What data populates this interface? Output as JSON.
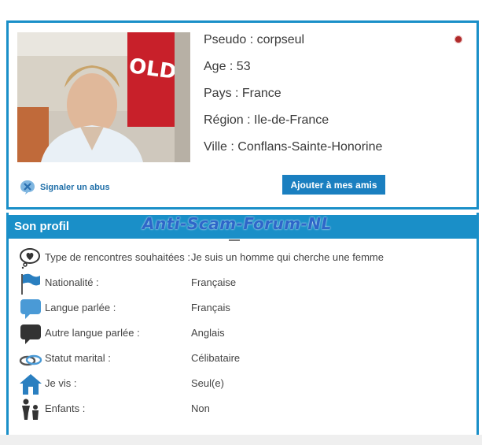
{
  "user": {
    "pseudo": "Pseudo : corpseul",
    "age": "Age : 53",
    "pays": "Pays : France",
    "region": "Région : Ile-de-France",
    "ville": "Ville : Conflans-Sainte-Honorine"
  },
  "actions": {
    "report_label": "Signaler un abus",
    "add_friend_label": "Ajouter à mes amis"
  },
  "watermark": "Anti-Scam-Forum-NL",
  "photo_sign": "OLD",
  "profile": {
    "title": "Son profil",
    "rows": [
      {
        "icon": "heart-bubble-icon",
        "label": "Type de rencontres souhaitées :",
        "value": "Je suis un homme qui cherche une femme"
      },
      {
        "icon": "flag-icon",
        "label": "Nationalité :",
        "value": "Française"
      },
      {
        "icon": "speech-bubble-icon",
        "label": "Langue parlée :",
        "value": "Français"
      },
      {
        "icon": "dark-speech-bubble-icon",
        "label": "Autre langue parlée :",
        "value": "Anglais"
      },
      {
        "icon": "rings-icon",
        "label": "Statut marital :",
        "value": "Célibataire"
      },
      {
        "icon": "house-icon",
        "label": "Je vis :",
        "value": "Seul(e)"
      },
      {
        "icon": "family-icon",
        "label": "Enfants :",
        "value": "Non"
      }
    ]
  },
  "colors": {
    "accent": "#1a8fc8",
    "button": "#1a7fc0",
    "link": "#1e6ea8",
    "status_dot": "#b02a2a",
    "watermark": "#2e66c9"
  }
}
